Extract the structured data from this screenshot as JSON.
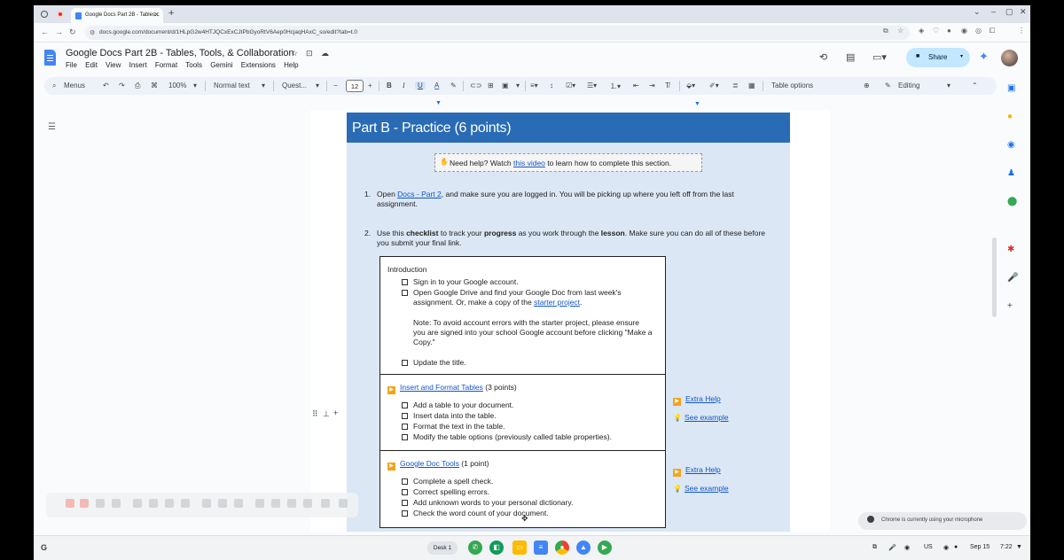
{
  "browser": {
    "tab_title": "Google Docs Part 2B - Tables...",
    "url": "docs.google.com/document/d/1HLpG2w4HTJQCxExCJtPbGyoRtV6Aep0HcjaqHAxC_so/edit?tab=t.0"
  },
  "docs": {
    "title": "Google Docs Part 2B - Tables, Tools, & Collaboration",
    "menus": [
      "File",
      "Edit",
      "View",
      "Insert",
      "Format",
      "Tools",
      "Gemini",
      "Extensions",
      "Help"
    ],
    "share_label": "Share"
  },
  "toolbar": {
    "menus_label": "Menus",
    "zoom": "100%",
    "style": "Normal text",
    "font": "Quest...",
    "font_size": "12",
    "table_options": "Table options",
    "mode": "Editing"
  },
  "doc": {
    "banner": "Part B - Practice (6 points)",
    "help": {
      "prefix": "Need help? Watch ",
      "link": "this video",
      "suffix": " to learn how to complete this section."
    },
    "item1": {
      "num": "1.",
      "pre": "Open ",
      "link": "Docs - Part 2",
      "post": ", and make sure you are logged in. You will be picking up where you left off from the last assignment."
    },
    "item2": {
      "num": "2.",
      "t1": "Use this ",
      "b1": "checklist",
      "t2": " to track your ",
      "b2": "progress",
      "t3": " as you work through the ",
      "b3": "lesson",
      "t4": ". Make sure you can do all of these before you submit your final link."
    },
    "intro": {
      "heading": "Introduction",
      "c1": "Sign in to your Google account.",
      "c2_pre": "Open Google Drive and find your Google Doc from last week's assignment. Or, make a copy of the ",
      "c2_link": "starter project",
      "c2_post": ".",
      "note": "Note: To avoid account errors with the starter project, please ensure you are signed into your school Google account before clicking \"Make a Copy.\"",
      "c3": "Update the title."
    },
    "tables": {
      "link": "Insert and Format Tables",
      "points": " (3 points)",
      "items": [
        "Add a table to your document.",
        "Insert data into the table.",
        "Format the text in the table.",
        "Modify the table options (previously called table properties)."
      ],
      "extra_help": "Extra Help",
      "see_example": "See example"
    },
    "tools": {
      "link": "Google Doc Tools",
      "points": " (1 point)",
      "items": [
        "Complete a spell check.",
        "Correct spelling errors.",
        "Add unknown words to your personal dictionary.",
        "Check the word count of your document."
      ],
      "extra_help": "Extra Help",
      "see_example": "See example"
    }
  },
  "system": {
    "notification": "Chrome is currently using your microphone",
    "desk": "Desk 1",
    "locale": "US",
    "date": "Sep 15",
    "time": "7:22"
  },
  "colors": {
    "banner": "#2a6bb5",
    "page_bg": "#dbe7f4",
    "link": "#1155cc",
    "share_bg": "#c2e7ff"
  }
}
